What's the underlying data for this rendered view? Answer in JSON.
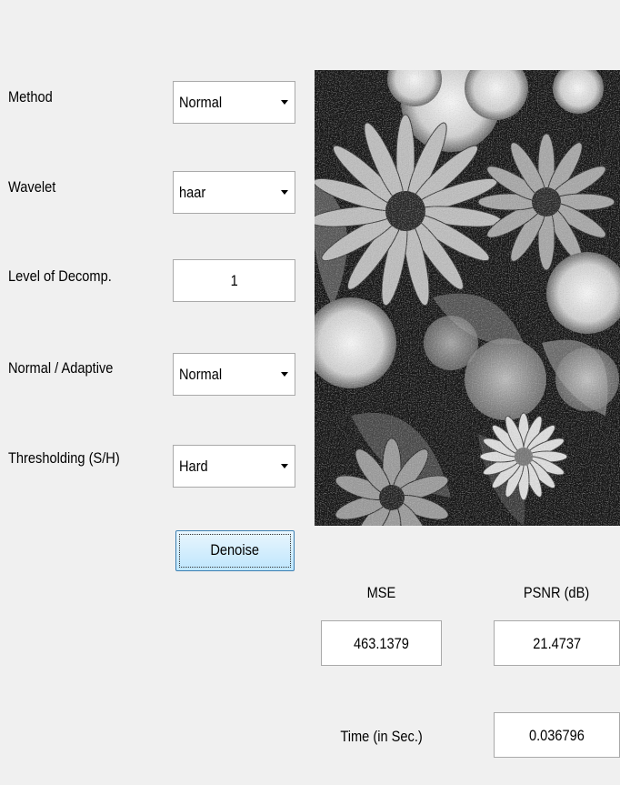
{
  "controls": {
    "method": {
      "label": "Method",
      "value": "Normal"
    },
    "wavelet": {
      "label": "Wavelet",
      "value": "haar"
    },
    "level": {
      "label": "Level of Decomp.",
      "value": "1"
    },
    "normal_adaptive": {
      "label": "Normal / Adaptive",
      "value": "Normal"
    },
    "thresholding": {
      "label": "Thresholding (S/H)",
      "value": "Hard"
    },
    "denoise_label": "Denoise"
  },
  "results": {
    "mse_label": "MSE",
    "mse_value": "463.1379",
    "psnr_label": "PSNR (dB)",
    "psnr_value": "21.4737",
    "time_label": "Time (in Sec.)",
    "time_value": "0.036796"
  },
  "image": {
    "description_icon": "flowers-grayscale-image"
  }
}
